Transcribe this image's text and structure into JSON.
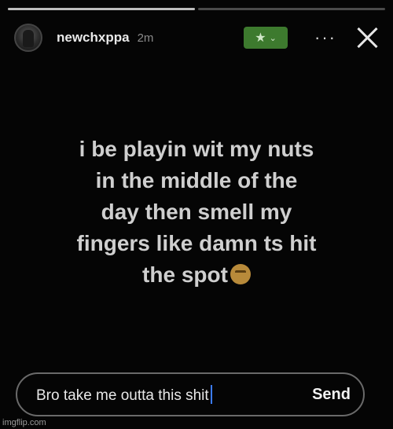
{
  "progress": [
    1,
    0
  ],
  "story": {
    "username": "newchxppa",
    "time": "2m",
    "close_friends_star": "★",
    "close_friends_chevron": "⌄",
    "more_label": "···",
    "text": "i be playin wit my nuts\nin the middle of the\nday then smell my\nfingers like damn ts hit\nthe spot",
    "emoji_icon": "smirk-emoji-icon"
  },
  "reply": {
    "value": "Bro take me outta this shit",
    "send_label": "Send"
  },
  "watermark": "imgflip.com",
  "colors": {
    "close_friends_green": "#3d7a2e",
    "caret_blue": "#3b7cff"
  }
}
